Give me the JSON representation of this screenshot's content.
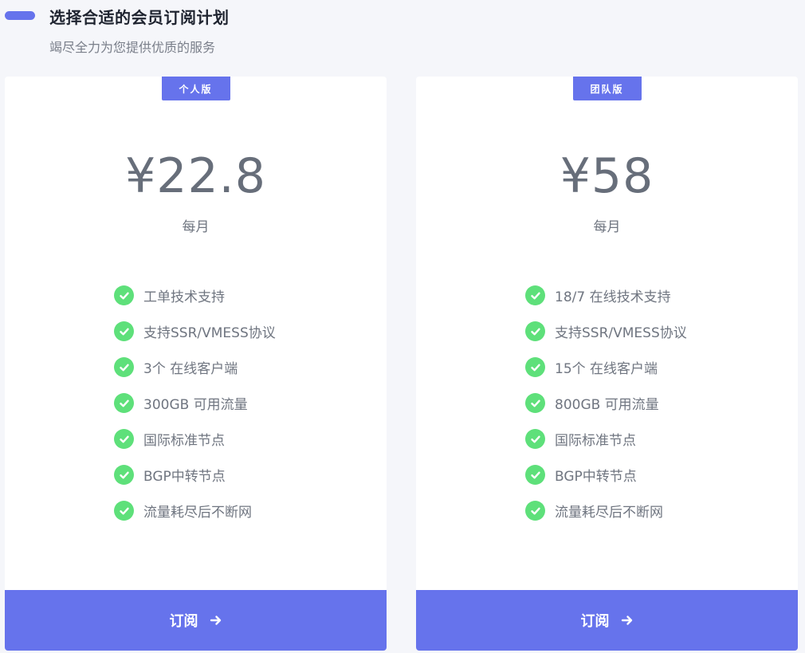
{
  "header": {
    "title": "选择合适的会员订阅计划",
    "subtitle": "竭尽全力为您提供优质的服务"
  },
  "colors": {
    "accent": "#6673ec",
    "check": "#5ee07a",
    "price_text": "#676e7a"
  },
  "plans": [
    {
      "badge": "个人版",
      "price": "¥22.8",
      "period": "每月",
      "features": [
        "工单技术支持",
        "支持SSR/VMESS协议",
        "3个 在线客户端",
        "300GB 可用流量",
        "国际标准节点",
        "BGP中转节点",
        "流量耗尽后不断网"
      ],
      "button_label": "订阅"
    },
    {
      "badge": "团队版",
      "price": "¥58",
      "period": "每月",
      "features": [
        "18/7 在线技术支持",
        "支持SSR/VMESS协议",
        "15个 在线客户端",
        "800GB 可用流量",
        "国际标准节点",
        "BGP中转节点",
        "流量耗尽后不断网"
      ],
      "button_label": "订阅"
    }
  ],
  "icons": {
    "feature": "check-circle-icon",
    "button": "arrow-right-icon"
  }
}
